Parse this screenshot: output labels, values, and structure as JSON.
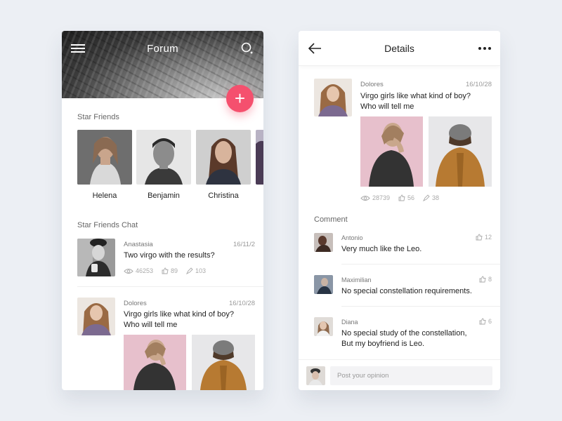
{
  "forum": {
    "title": "Forum",
    "star_friends_label": "Star Friends",
    "friends": [
      {
        "name": "Helena"
      },
      {
        "name": "Benjamin"
      },
      {
        "name": "Christina"
      }
    ],
    "chat_label": "Star Friends Chat",
    "posts": [
      {
        "author": "Anastasia",
        "date": "16/11/2",
        "text": "Two virgo with the results?",
        "views": "46253",
        "likes": "89",
        "shares": "103"
      },
      {
        "author": "Dolores",
        "date": "16/10/28",
        "text_line1": "Virgo girls like what kind of boy?",
        "text_line2": "Who will tell me"
      }
    ]
  },
  "details": {
    "title": "Details",
    "post": {
      "author": "Dolores",
      "date": "16/10/28",
      "text_line1": "Virgo girls like what kind of boy?",
      "text_line2": "Who will tell me",
      "views": "28739",
      "likes": "56",
      "shares": "38"
    },
    "comment_label": "Comment",
    "comments": [
      {
        "author": "Antonio",
        "text_line1": "Very much like the Leo.",
        "likes": "12"
      },
      {
        "author": "Maximilian",
        "text_line1": "No special constellation requirements.",
        "likes": "8"
      },
      {
        "author": "Diana",
        "text_line1": "No special study of the constellation,",
        "text_line2": "But my boyfriend is Leo.",
        "likes": "6"
      }
    ],
    "composer_placeholder": "Post your opinion"
  },
  "colors": {
    "accent": "#f5506e",
    "background": "#eceff4"
  },
  "icons": [
    "menu-icon",
    "search-icon",
    "plus-icon",
    "back-arrow-icon",
    "more-dots-icon",
    "eye-icon",
    "thumbs-up-icon",
    "share-icon"
  ]
}
